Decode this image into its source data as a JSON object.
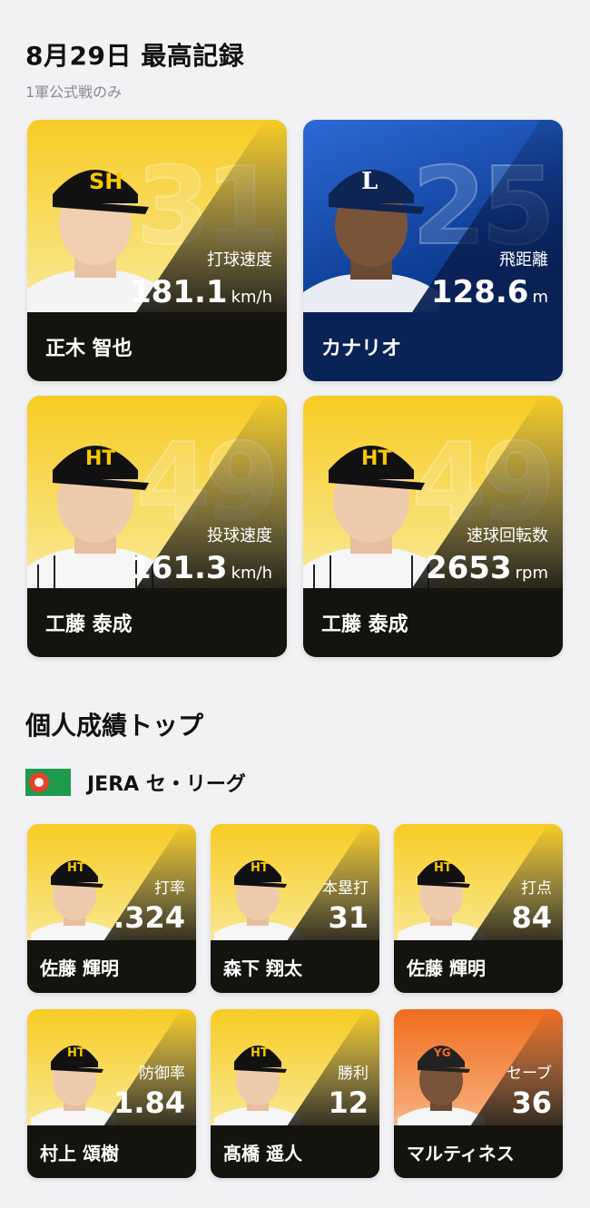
{
  "header": {
    "title": "8月29日 最高記録",
    "subtitle": "1軍公式戦のみ"
  },
  "records": [
    {
      "name": "正木 智也",
      "jersey": "31",
      "stat_label": "打球速度",
      "value": "181.1",
      "unit": "km/h",
      "theme": "gold",
      "cap_logo": "SH"
    },
    {
      "name": "カナリオ",
      "jersey": "25",
      "stat_label": "飛距離",
      "value": "128.6",
      "unit": "m",
      "theme": "navy",
      "cap_logo": "L"
    },
    {
      "name": "工藤 泰成",
      "jersey": "49",
      "stat_label": "投球速度",
      "value": "161.3",
      "unit": "km/h",
      "theme": "gold",
      "cap_logo": "HT"
    },
    {
      "name": "工藤 泰成",
      "jersey": "49",
      "stat_label": "速球回転数",
      "value": "2653",
      "unit": "rpm",
      "theme": "gold",
      "cap_logo": "HT"
    }
  ],
  "leaders": {
    "section_title": "個人成績トップ",
    "league_name": "JERA セ・リーグ",
    "items": [
      {
        "name": "佐藤 輝明",
        "stat_label": "打率",
        "value": ".324",
        "theme": "gold"
      },
      {
        "name": "森下 翔太",
        "stat_label": "本塁打",
        "value": "31",
        "theme": "gold"
      },
      {
        "name": "佐藤 輝明",
        "stat_label": "打点",
        "value": "84",
        "theme": "gold"
      },
      {
        "name": "村上 頌樹",
        "stat_label": "防御率",
        "value": "1.84",
        "theme": "gold"
      },
      {
        "name": "髙橋 遥人",
        "stat_label": "勝利",
        "value": "12",
        "theme": "gold"
      },
      {
        "name": "マルティネス",
        "stat_label": "セーブ",
        "value": "36",
        "theme": "orange"
      }
    ]
  },
  "colors": {
    "gold": "#f7cc24",
    "navy": "#0d3d94",
    "orange": "#f06d1f",
    "dark": "#15130e",
    "league_green": "#1d9a4b",
    "league_red": "#e8412c"
  }
}
